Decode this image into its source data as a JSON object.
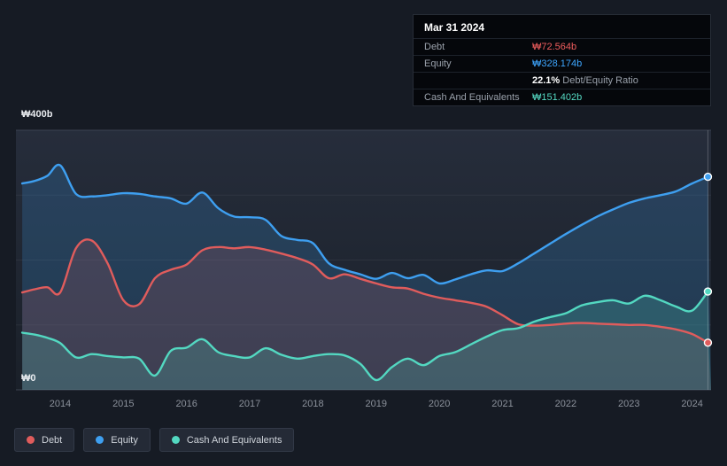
{
  "axis": {
    "y_top": "₩400b",
    "y_bottom": "₩0"
  },
  "tooltip": {
    "date": "Mar 31 2024",
    "debt_label": "Debt",
    "debt_value": "₩72.564b",
    "equity_label": "Equity",
    "equity_value": "₩328.174b",
    "ratio_value": "22.1%",
    "ratio_label": "Debt/Equity Ratio",
    "cash_label": "Cash And Equivalents",
    "cash_value": "₩151.402b"
  },
  "legend": {
    "items": [
      {
        "label": "Debt",
        "color": "#e05c5c"
      },
      {
        "label": "Equity",
        "color": "#3e9ff0"
      },
      {
        "label": "Cash And Equivalents",
        "color": "#53d8c1"
      }
    ]
  },
  "chart_data": {
    "type": "area",
    "xlim": [
      2013.3,
      2024.3
    ],
    "ylim": [
      0,
      400
    ],
    "y_gridlines": [
      0,
      100,
      200,
      300,
      400
    ],
    "y_tick_labels": {
      "top": "₩400b",
      "bottom": "₩0"
    },
    "x_ticks": [
      2014,
      2015,
      2016,
      2017,
      2018,
      2019,
      2020,
      2021,
      2022,
      2023,
      2024
    ],
    "x_unit": "year",
    "selected_point": {
      "date": "Mar 31 2024",
      "debt": 72.564,
      "equity": 328.174,
      "cash": 151.402,
      "debt_equity_ratio_pct": 22.1
    },
    "x": [
      2013.4,
      2013.6,
      2013.8,
      2014.0,
      2014.25,
      2014.5,
      2014.75,
      2015.0,
      2015.25,
      2015.5,
      2015.75,
      2016.0,
      2016.25,
      2016.5,
      2016.75,
      2017.0,
      2017.25,
      2017.5,
      2017.75,
      2018.0,
      2018.25,
      2018.5,
      2018.75,
      2019.0,
      2019.25,
      2019.5,
      2019.75,
      2020.0,
      2020.25,
      2020.5,
      2020.75,
      2021.0,
      2021.25,
      2021.5,
      2021.75,
      2022.0,
      2022.25,
      2022.5,
      2022.75,
      2023.0,
      2023.25,
      2023.5,
      2023.75,
      2024.0,
      2024.25
    ],
    "series": [
      {
        "name": "Equity",
        "key": "equity",
        "unit": "₩b",
        "color": "#3e9ff0",
        "fill": "rgba(62,159,240,0.20)",
        "values": [
          318,
          322,
          330,
          346,
          302,
          298,
          300,
          303,
          302,
          298,
          295,
          287,
          304,
          280,
          267,
          266,
          262,
          237,
          231,
          226,
          195,
          185,
          178,
          171,
          180,
          172,
          177,
          164,
          170,
          178,
          184,
          183,
          195,
          210,
          225,
          240,
          254,
          267,
          278,
          288,
          295,
          300,
          306,
          318,
          328.2
        ]
      },
      {
        "name": "Debt",
        "key": "debt",
        "unit": "₩b",
        "color": "#e05c5c",
        "fill": "rgba(224,92,92,0.16)",
        "values": [
          150,
          155,
          158,
          150,
          218,
          230,
          195,
          138,
          132,
          172,
          185,
          193,
          215,
          220,
          218,
          220,
          216,
          210,
          203,
          193,
          172,
          178,
          171,
          164,
          158,
          156,
          148,
          142,
          138,
          134,
          128,
          115,
          101,
          99,
          100,
          102,
          103,
          102,
          101,
          100,
          100,
          97,
          93,
          86,
          72.6
        ]
      },
      {
        "name": "Cash And Equivalents",
        "key": "cash",
        "unit": "₩b",
        "color": "#53d8c1",
        "fill": "rgba(83,216,193,0.20)",
        "values": [
          88,
          85,
          80,
          72,
          50,
          55,
          52,
          50,
          48,
          22,
          60,
          65,
          78,
          58,
          52,
          50,
          64,
          54,
          48,
          52,
          55,
          53,
          40,
          15,
          35,
          48,
          38,
          52,
          58,
          70,
          82,
          92,
          95,
          105,
          112,
          118,
          130,
          135,
          138,
          133,
          145,
          138,
          128,
          122,
          151.4
        ]
      }
    ],
    "grid": true,
    "legend_position": "bottom-left"
  }
}
